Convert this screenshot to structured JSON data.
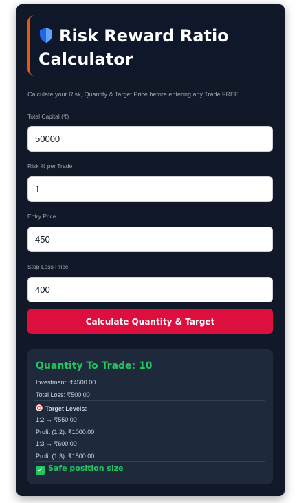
{
  "header": {
    "title": "Risk Reward Ratio Calculator",
    "icon": "shield-icon",
    "accent_color": "#ea580c"
  },
  "subtitle": "Calculate your Risk, Quantity & Target Price before entering any Trade FREE.",
  "form": {
    "capital": {
      "label": "Total Capital (₹)",
      "value": "50000"
    },
    "risk": {
      "label": "Risk % per Trade",
      "value": "1"
    },
    "entry": {
      "label": "Entry Price",
      "value": "450"
    },
    "stoploss": {
      "label": "Stop Loss Price",
      "value": "400"
    }
  },
  "button": {
    "label": "Calculate Quantity & Target",
    "color": "#dc0f3f"
  },
  "result": {
    "quantity": "Quantity To Trade: 10",
    "investment": "Investment: ₹4500.00",
    "total_loss": "Total Loss: ₹500.00",
    "target_heading": "Target Levels:",
    "target_icon": "target-icon",
    "t1": "1:2 → ₹550.00",
    "p1": "Profit (1:2): ₹1000.00",
    "t2": "1:3 → ₹600.00",
    "p2": "Profit (1:3): ₹1500.00",
    "status": "Safe position size",
    "status_icon": "check-icon",
    "status_color": "#22c55e"
  }
}
